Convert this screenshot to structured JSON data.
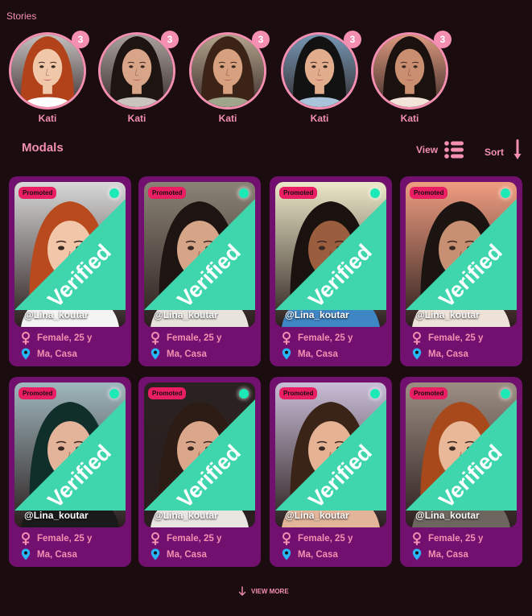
{
  "stories": {
    "label": "Stories",
    "items": [
      {
        "name": "Kati",
        "count": "3",
        "hair": "#b2421a",
        "bg": "#d9d6d3",
        "skin": "#f1c7aa",
        "shirt": "#ffffff"
      },
      {
        "name": "Kati",
        "count": "3",
        "hair": "#1e1412",
        "bg": "#b8b3ad",
        "skin": "#d9a588",
        "shirt": "#c9c4be"
      },
      {
        "name": "Kati",
        "count": "3",
        "hair": "#3b2417",
        "bg": "#c4b49a",
        "skin": "#d7a07e",
        "shirt": "#9fa58a"
      },
      {
        "name": "Kati",
        "count": "3",
        "hair": "#121212",
        "bg": "#7fa7c7",
        "skin": "#e1ad8d",
        "shirt": "#a9c4da"
      },
      {
        "name": "Kati",
        "count": "3",
        "hair": "#1b1210",
        "bg": "#f2a98a",
        "skin": "#c98f70",
        "shirt": "#f3e4da"
      }
    ]
  },
  "models": {
    "title": "Modals",
    "view_label": "View",
    "sort_label": "Sort",
    "promo_label": "Promoted",
    "verified_label": "Verified",
    "cards": [
      {
        "handle": "@Lina_koutar",
        "gender": "Female, 25 y",
        "location": "Ma, Casa",
        "hair": "#b84a1d",
        "bg": "#d8d8d8",
        "skin": "#f2c6a8",
        "shirt": "#f4f4f4"
      },
      {
        "handle": "@Lina_koutar",
        "gender": "Female, 25 y",
        "location": "Ma, Casa",
        "hair": "#1e1512",
        "bg": "#8b8376",
        "skin": "#d6a588",
        "shirt": "#e8e3dc"
      },
      {
        "handle": "@Lina_koutar",
        "gender": "Female, 25 y",
        "location": "Ma, Casa",
        "hair": "#1a120e",
        "bg": "#ece9c8",
        "skin": "#9a5e3e",
        "shirt": "#3f86c4"
      },
      {
        "handle": "@Lina_koutar",
        "gender": "Female, 25 y",
        "location": "Ma, Casa",
        "hair": "#1b1411",
        "bg": "#ef9d80",
        "skin": "#c89072",
        "shirt": "#efe2d8"
      },
      {
        "handle": "@Lina_koutar",
        "gender": "Female, 25 y",
        "location": "Ma, Casa",
        "hair": "#102e2a",
        "bg": "#9fb7bd",
        "skin": "#e3b49a",
        "shirt": "#1a1a1a"
      },
      {
        "handle": "@Lina_koutar",
        "gender": "Female, 25 y",
        "location": "Ma, Casa",
        "hair": "#2c1c15",
        "bg": "#2a2220",
        "skin": "#dba78b",
        "shirt": "#e9e6e2"
      },
      {
        "handle": "@Lina_koutar",
        "gender": "Female, 25 y",
        "location": "Ma, Casa",
        "hair": "#3a2418",
        "bg": "#c8bdd6",
        "skin": "#e5b294",
        "shirt": "#e2b49a"
      },
      {
        "handle": "@Lina_koutar",
        "gender": "Female, 25 y",
        "location": "Ma, Casa",
        "hair": "#a8491c",
        "bg": "#9c8e82",
        "skin": "#e8b898",
        "shirt": "#6d665e"
      }
    ]
  },
  "footer": {
    "view_more_label": "VIEW MORE"
  },
  "colors": {
    "background": "#1a0c0f",
    "accent": "#f48fb1",
    "card": "#71106e",
    "promo": "#e91e63",
    "online": "#1de9b6",
    "verified": "#3fd6ae",
    "location_pin": "#29b6f6"
  }
}
